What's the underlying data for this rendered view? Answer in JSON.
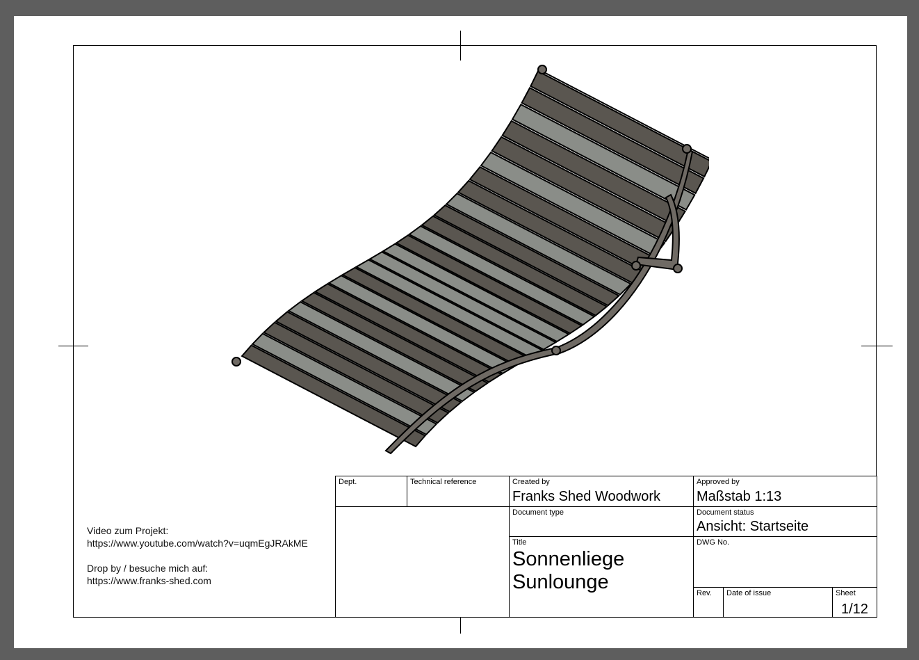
{
  "notes": {
    "video_label": "Video zum Projekt:",
    "video_url": "https://www.youtube.com/watch?v=uqmEgJRAkME",
    "visit_label": "Drop by / besuche mich auf:",
    "visit_url": "https://www.franks-shed.com"
  },
  "title_block": {
    "dept_label": "Dept.",
    "dept_value": "",
    "tech_ref_label": "Technical reference",
    "tech_ref_value": "",
    "created_by_label": "Created by",
    "created_by_value": "Franks Shed Woodwork",
    "approved_by_label": "Approved by",
    "approved_by_value": "Maßstab 1:13",
    "doc_type_label": "Document type",
    "doc_type_value": "",
    "doc_status_label": "Document status",
    "doc_status_value": "Ansicht: Startseite",
    "title_label": "Title",
    "title_line1": "Sonnenliege",
    "title_line2": "Sunlounge",
    "dwg_no_label": "DWG No.",
    "dwg_no_value": "",
    "rev_label": "Rev.",
    "date_of_issue_label": "Date of issue",
    "sheet_label": "Sheet",
    "sheet_value": "1/12"
  },
  "drawing": {
    "subject": "sun-lounger-isometric-view",
    "colors": {
      "slat_dark": "#5a5650",
      "slat_light": "#8a8d88",
      "frame": "#6f6a64",
      "outline": "#000000"
    }
  }
}
